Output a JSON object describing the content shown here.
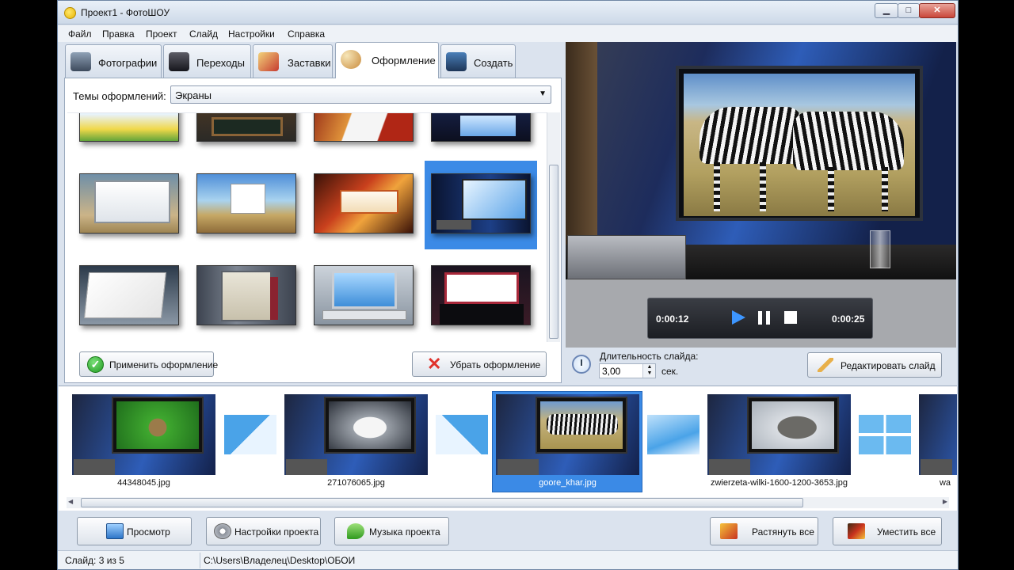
{
  "window": {
    "title": "Проект1 - ФотоШОУ",
    "minimize_icon": "minimize-icon",
    "maximize_icon": "maximize-icon",
    "close_icon": "close-icon",
    "min_glyph": "▁",
    "max_glyph": "□",
    "close_glyph": "✕"
  },
  "menu": {
    "items": [
      "Файл",
      "Правка",
      "Проект",
      "Слайд",
      "Настройки",
      "Справка"
    ]
  },
  "tabs": [
    {
      "label": "Фотографии",
      "icon": "camera-icon",
      "active": false
    },
    {
      "label": "Переходы",
      "icon": "magic-hat-icon",
      "active": false
    },
    {
      "label": "Заставки",
      "icon": "clapper-icon",
      "active": false
    },
    {
      "label": "Оформление",
      "icon": "palette-icon",
      "active": true
    },
    {
      "label": "Создать",
      "icon": "film-camera-icon",
      "active": false
    }
  ],
  "themes": {
    "label": "Темы оформлений:",
    "selected": "Экраны",
    "arrow": "▼"
  },
  "actions": {
    "apply": "Применить оформление",
    "remove": "Убрать оформление",
    "check": "✓",
    "cross": "✕"
  },
  "player": {
    "current_time": "0:00:12",
    "total_time": "0:00:25",
    "playing": true
  },
  "slide_duration": {
    "label": "Длительность слайда:",
    "value": "3,00",
    "unit": "сек.",
    "stepper": "▲▼"
  },
  "edit_slide": "Редактировать слайд",
  "timeline": {
    "slides": [
      {
        "name": "44348045.jpg",
        "subject": "kitten"
      },
      {
        "name": "271076065.jpg",
        "subject": "snowy-owl"
      },
      {
        "name": "goore_khar.jpg",
        "subject": "zebras",
        "selected": true
      },
      {
        "name": "zwierzeta-wilki-1600-1200-3653.jpg",
        "subject": "wolf"
      },
      {
        "name": "wa",
        "subject": "partial"
      }
    ],
    "transitions": [
      "diagonal-wipe",
      "diagonal-wipe",
      "corner-wipe",
      "four-squares"
    ],
    "scroll_left": "◀",
    "scroll_right": "▶"
  },
  "toolbar": {
    "preview": "Просмотр",
    "project_settings": "Настройки проекта",
    "project_music": "Музыка проекта",
    "stretch_all": "Растянуть все",
    "fit_all": "Уместить все"
  },
  "status": {
    "slide": "Слайд: 3 из 5",
    "path": "C:\\Users\\Владелец\\Desktop\\ОБОИ"
  }
}
